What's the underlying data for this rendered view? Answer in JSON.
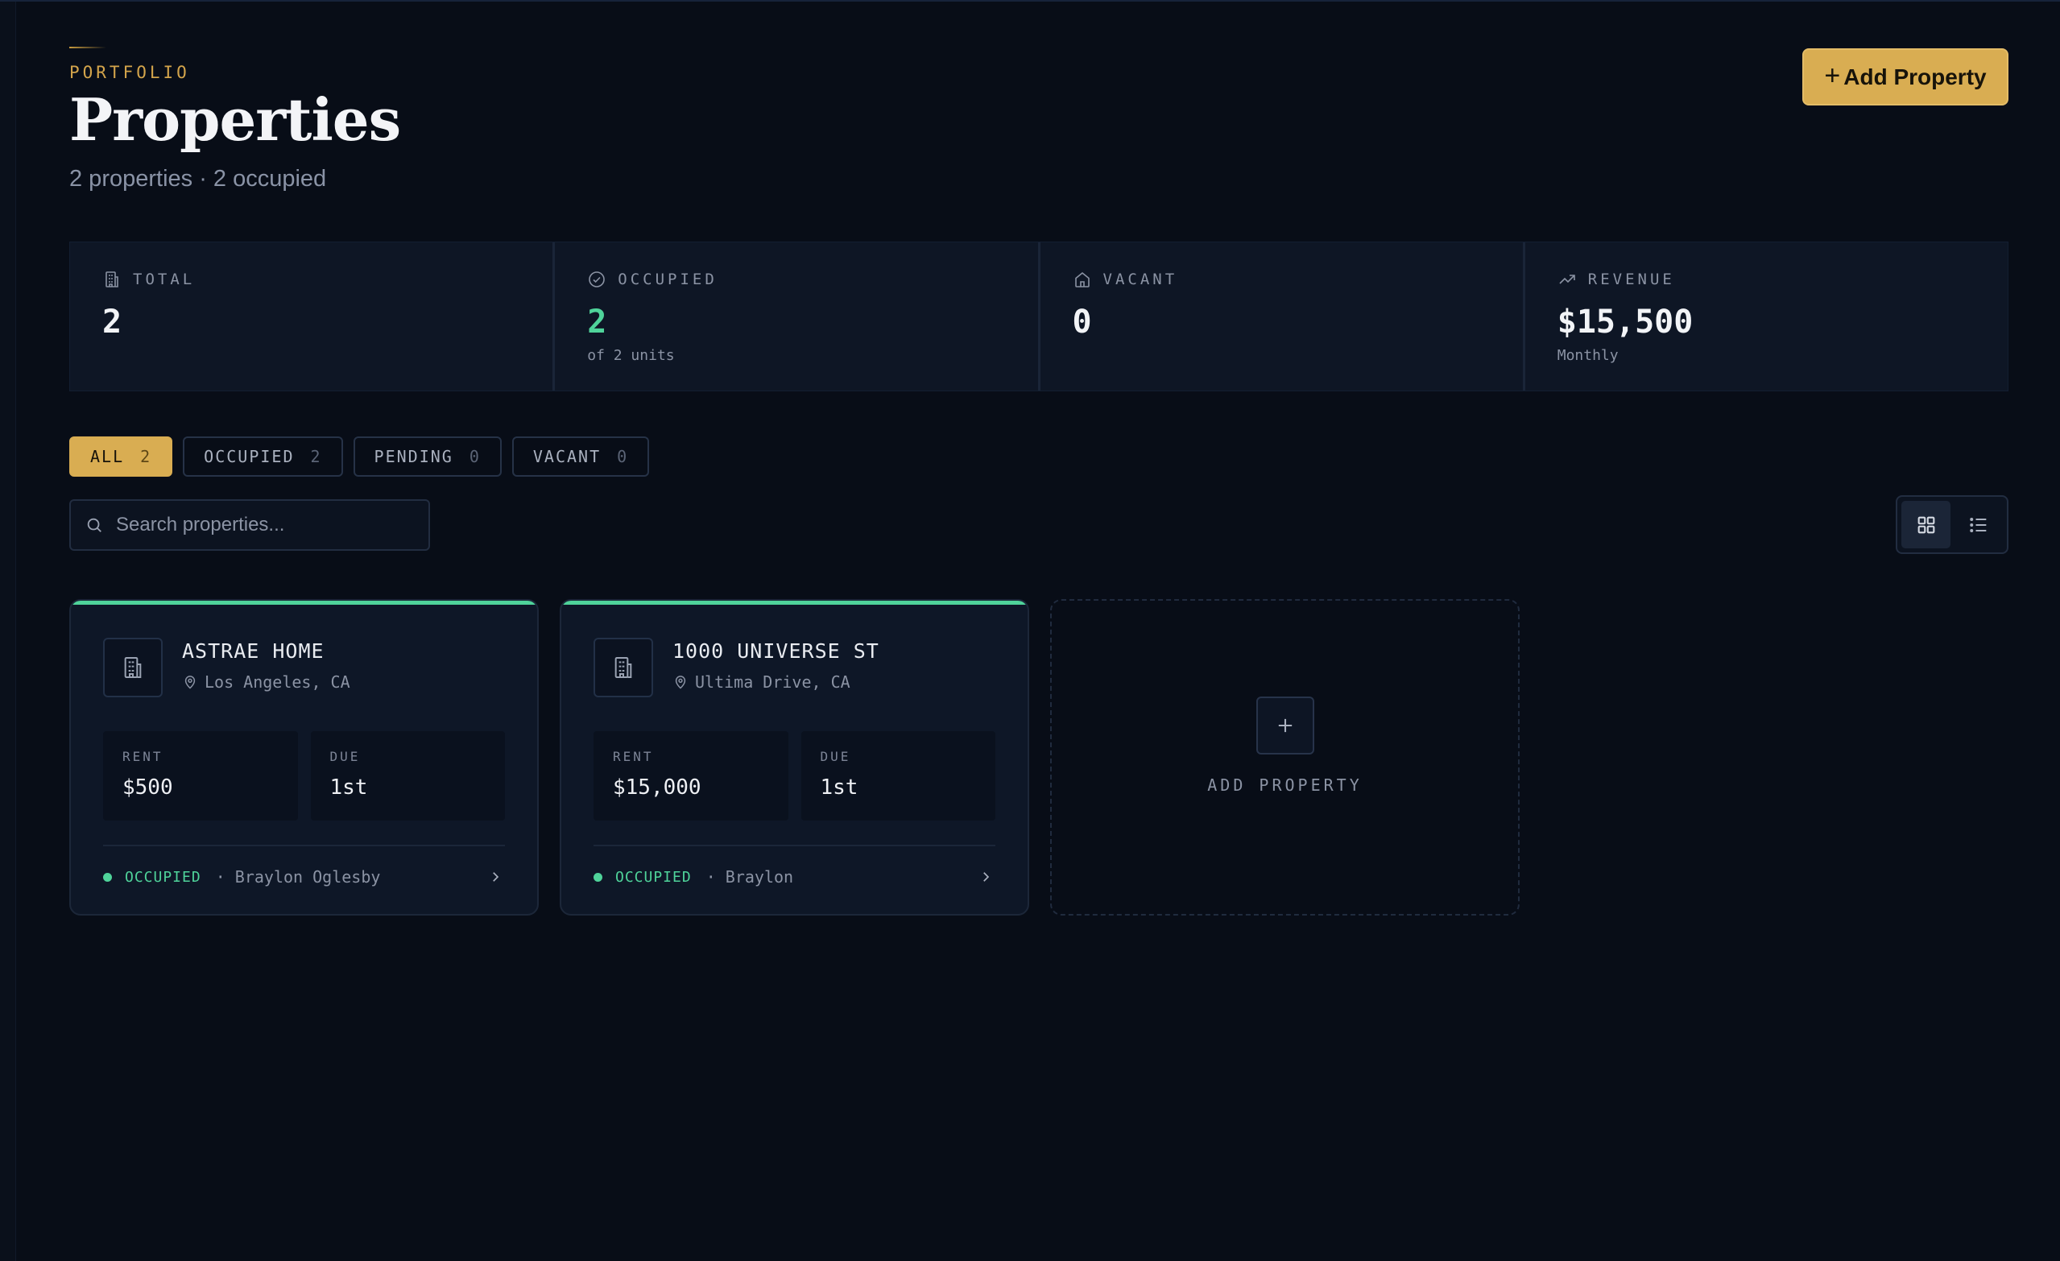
{
  "header": {
    "eyebrow": "PORTFOLIO",
    "title": "Properties",
    "subtitle": "2 properties · 2 occupied",
    "add_button": {
      "icon": "plus-icon",
      "label": "Add Property"
    }
  },
  "stats": [
    {
      "icon": "building-icon",
      "label": "TOTAL",
      "value": "2",
      "sub": ""
    },
    {
      "icon": "check-circle-icon",
      "label": "OCCUPIED",
      "value": "2",
      "sub": "of 2 units",
      "color": "#4fd39a"
    },
    {
      "icon": "home-icon",
      "label": "VACANT",
      "value": "0",
      "sub": ""
    },
    {
      "icon": "trending-up-icon",
      "label": "REVENUE",
      "value": "$15,500",
      "sub": "Monthly"
    }
  ],
  "filters": [
    {
      "label": "ALL",
      "count": "2",
      "active": true
    },
    {
      "label": "OCCUPIED",
      "count": "2",
      "active": false
    },
    {
      "label": "PENDING",
      "count": "0",
      "active": false
    },
    {
      "label": "VACANT",
      "count": "0",
      "active": false
    }
  ],
  "search": {
    "placeholder": "Search properties..."
  },
  "view_toggle": {
    "active": "grid",
    "options": [
      "grid-icon",
      "list-icon"
    ]
  },
  "properties": [
    {
      "name": "ASTRAE HOME",
      "location": "Los Angeles, CA",
      "rent_label": "RENT",
      "rent": "$500",
      "due_label": "DUE",
      "due": "1st",
      "status": "OCCUPIED",
      "tenant": "· Braylon Oglesby"
    },
    {
      "name": "1000 UNIVERSE ST",
      "location": "Ultima Drive, CA",
      "rent_label": "RENT",
      "rent": "$15,000",
      "due_label": "DUE",
      "due": "1st",
      "status": "OCCUPIED",
      "tenant": "· Braylon"
    }
  ],
  "add_card": {
    "label": "ADD PROPERTY"
  },
  "colors": {
    "accent": "#d9ad52",
    "occupied": "#4fd39a",
    "background": "#080d17"
  }
}
